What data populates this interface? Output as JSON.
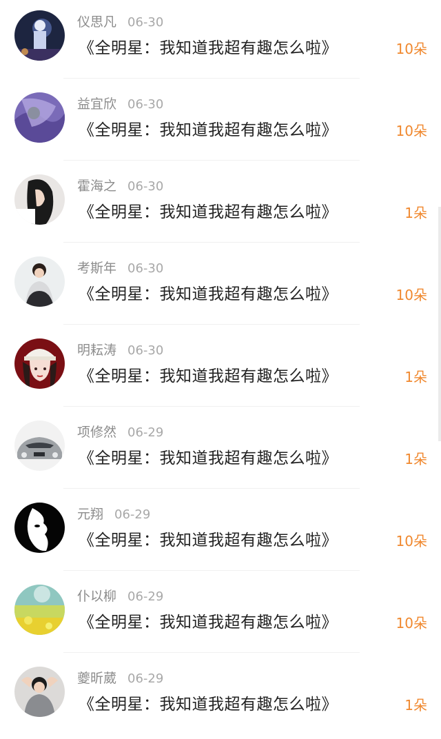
{
  "rows": [
    {
      "name": "仪思凡",
      "date": "06-30",
      "title": "《全明星：我知道我超有趣怎么啦》",
      "flowers": "10朵",
      "avatar": "night-statue-avatar"
    },
    {
      "name": "益宜欣",
      "date": "06-30",
      "title": "《全明星：我知道我超有趣怎么啦》",
      "flowers": "10朵",
      "avatar": "purple-gem-avatar"
    },
    {
      "name": "霍海之",
      "date": "06-30",
      "title": "《全明星：我知道我超有趣怎么啦》",
      "flowers": "1朵",
      "avatar": "girl-profile-avatar"
    },
    {
      "name": "考斯年",
      "date": "06-30",
      "title": "《全明星：我知道我超有趣怎么啦》",
      "flowers": "10朵",
      "avatar": "person-jacket-avatar"
    },
    {
      "name": "明耘涛",
      "date": "06-30",
      "title": "《全明星：我知道我超有趣怎么啦》",
      "flowers": "1朵",
      "avatar": "cap-girl-avatar"
    },
    {
      "name": "项修然",
      "date": "06-29",
      "title": "《全明星：我知道我超有趣怎么啦》",
      "flowers": "1朵",
      "avatar": "silver-car-avatar"
    },
    {
      "name": "元翔",
      "date": "06-29",
      "title": "《全明星：我知道我超有趣怎么啦》",
      "flowers": "10朵",
      "avatar": "mask-avatar"
    },
    {
      "name": "仆以柳",
      "date": "06-29",
      "title": "《全明星：我知道我超有趣怎么啦》",
      "flowers": "10朵",
      "avatar": "flower-field-avatar"
    },
    {
      "name": "夔昕葳",
      "date": "06-29",
      "title": "《全明星：我知道我超有趣怎么啦》",
      "flowers": "1朵",
      "avatar": "boy-hands-avatar"
    }
  ],
  "colors": {
    "name": "#8c8c8c",
    "title": "#222222",
    "flowers": "#f0882e",
    "divider": "#f0f0f0"
  }
}
